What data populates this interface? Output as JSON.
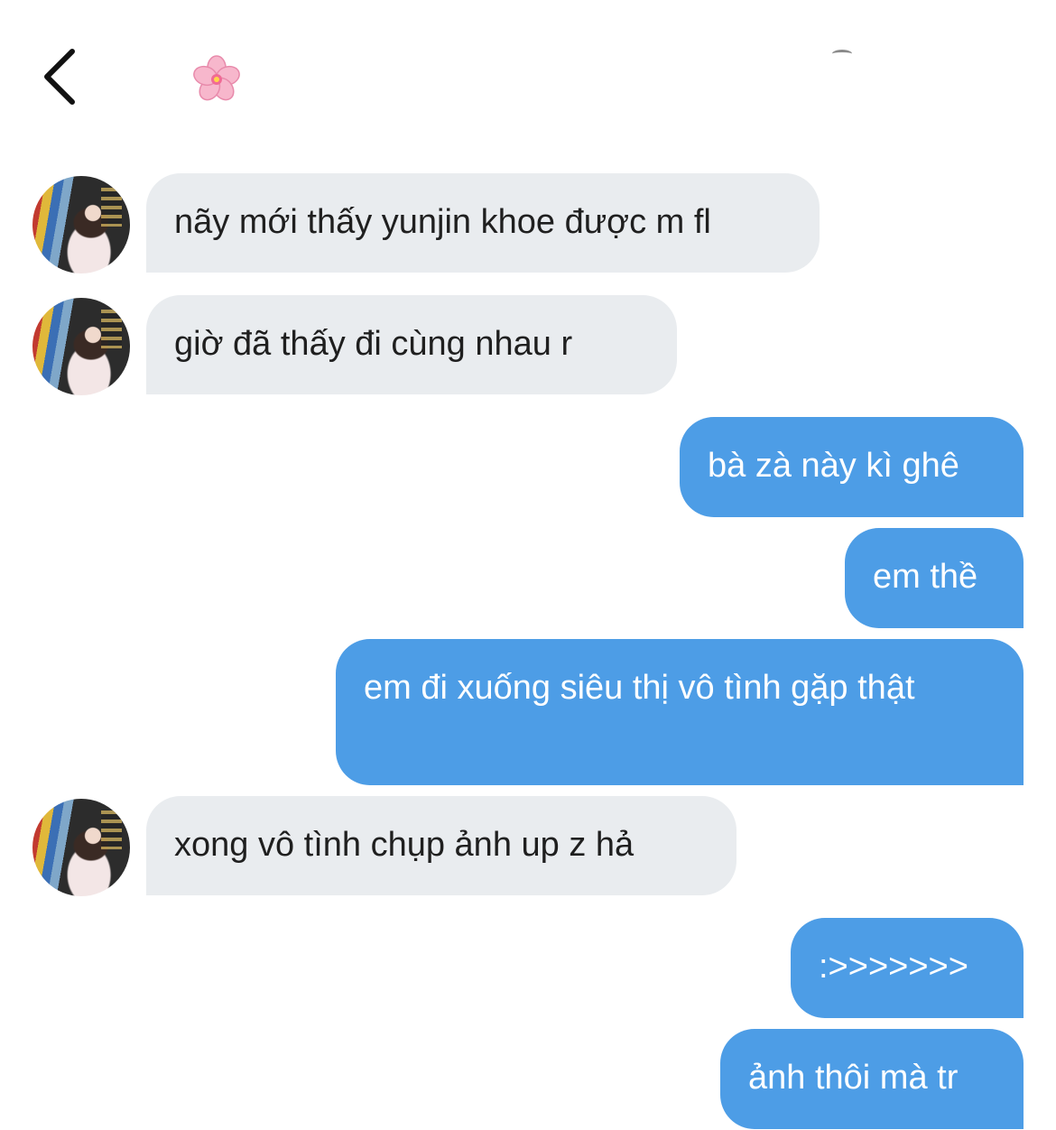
{
  "header": {
    "back_icon": "chevron-left-icon",
    "contact_emoji": "cherry-blossom-emoji"
  },
  "conversation": {
    "messages": [
      {
        "direction": "incoming",
        "text": "nãy mới thấy yunjin khoe được m fl",
        "avatar": "contact-avatar"
      },
      {
        "direction": "incoming",
        "text": "giờ đã thấy đi cùng nhau r",
        "avatar": "contact-avatar"
      },
      {
        "direction": "outgoing",
        "text": "bà zà này kì ghê"
      },
      {
        "direction": "outgoing",
        "text": "em thề"
      },
      {
        "direction": "outgoing",
        "text": "em đi xuống siêu thị vô tình gặp thật"
      },
      {
        "direction": "incoming",
        "text": "xong vô tình chụp ảnh up z hả",
        "avatar": "contact-avatar"
      },
      {
        "direction": "outgoing",
        "text": ":>>>>>>>"
      },
      {
        "direction": "outgoing",
        "text": "ảnh thôi mà tr"
      }
    ]
  },
  "colors": {
    "incoming_bubble": "#e9ecef",
    "outgoing_bubble": "#4d9de6",
    "outgoing_text": "#ffffff",
    "incoming_text": "#1f1f1f"
  }
}
